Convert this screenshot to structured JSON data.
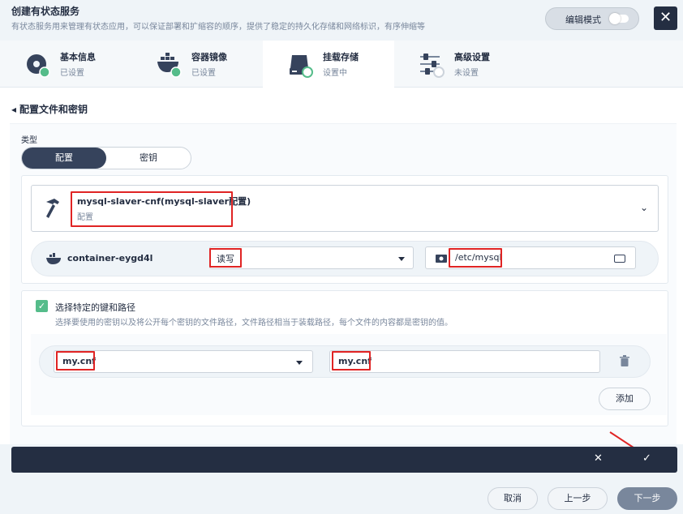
{
  "header": {
    "title": "创建有状态服务",
    "description": "有状态服务用来管理有状态应用，可以保证部署和扩缩容的顺序，提供了稳定的持久化存储和网络标识，有序伸缩等",
    "edit_mode_label": "编辑模式",
    "close_glyph": "✕"
  },
  "steps": [
    {
      "title": "基本信息",
      "status": "已设置"
    },
    {
      "title": "容器镜像",
      "status": "已设置"
    },
    {
      "title": "挂载存储",
      "status": "设置中"
    },
    {
      "title": "高级设置",
      "status": "未设置"
    }
  ],
  "page": {
    "back_label": "配置文件和密钥",
    "type_label": "类型",
    "type_options": [
      "配置",
      "密钥"
    ],
    "selected_type": "配置"
  },
  "secret_card": {
    "name": "mysql-slaver-cnf(mysql-slaver配置)",
    "kind": "配置"
  },
  "container_mount": {
    "container_name": "container-eygd4l",
    "access_mode": "读写",
    "mount_path": "/etc/mysql"
  },
  "specific_keys": {
    "checkbox_label": "选择特定的键和路径",
    "checkbox_checked": true,
    "description": "选择要使用的密钥以及将公开每个密钥的文件路径，文件路径相当于装载路径，每个文件的内容都是密钥的值。",
    "rows": [
      {
        "key": "my.cnf",
        "path": "my.cnf"
      }
    ],
    "add_label": "添加"
  },
  "confirm_bar": {
    "cancel_glyph": "✕",
    "confirm_glyph": "✓"
  },
  "footer": {
    "cancel_label": "取消",
    "prev_label": "上一步",
    "next_label": "下一步"
  },
  "colors": {
    "accent_dark": "#242e42",
    "success_green": "#55bc8a",
    "highlight_red": "#e02424"
  }
}
